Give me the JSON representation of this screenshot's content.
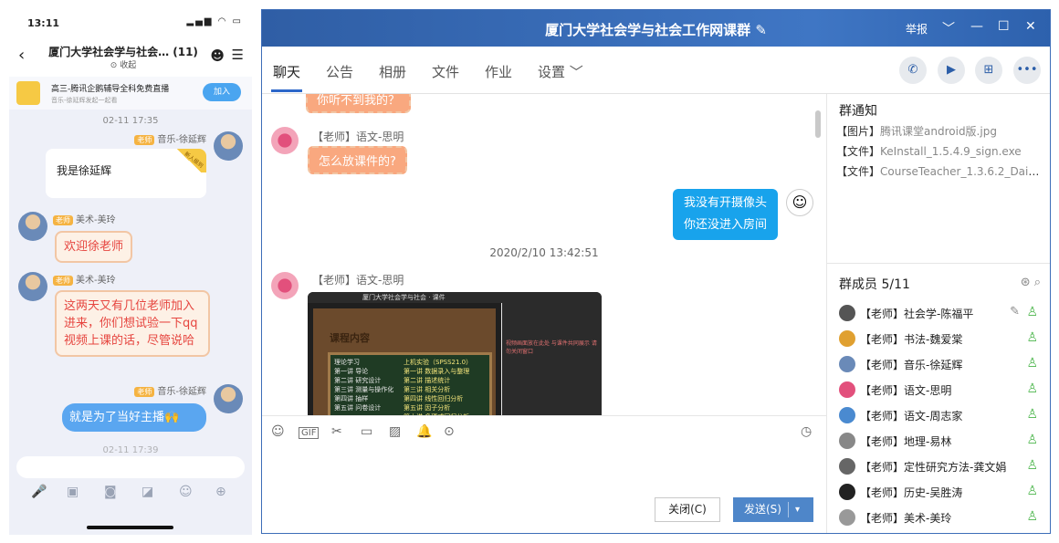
{
  "phone": {
    "status_time": "13:11",
    "status_icons": "▂▄▆ ◠ ▭",
    "back_icon": "‹",
    "title": "厦门大学社会学与社会…  (11)",
    "subtitle": "⊙ 收起",
    "emoji_icon": "☻",
    "menu_icon": "☰",
    "ad_title": "高三-腾讯企鹅辅导全科免费直播",
    "ad_sub": "音乐-徐延辉发起一起看",
    "ad_join": "加入",
    "new_badge": "新人报到",
    "messages": [
      {
        "time": "02-11 17:35"
      },
      {
        "tag": "老师",
        "sender": "音乐-徐延辉",
        "text": "我是徐延辉"
      },
      {
        "tag": "老师",
        "sender": "美术-美玲",
        "text": "欢迎徐老师"
      },
      {
        "tag": "老师",
        "sender": "美术-美玲",
        "text": "这两天又有几位老师加入进来，你们想试验一下qq视频上课的话，尽管说哈"
      },
      {
        "tag": "老师",
        "sender": "音乐-徐延辉",
        "text": "就是为了当好主播🙌"
      },
      {
        "time": "02-11 17:39"
      }
    ],
    "toolbar_icons": [
      "🎤",
      "▣",
      "◙",
      "◪",
      "☺",
      "⊕"
    ]
  },
  "window": {
    "title": "厦门大学社会学与社会工作网课群 ✎",
    "report": "举报",
    "controls": [
      "﹀",
      "—",
      "☐",
      "✕"
    ],
    "tabs": [
      "聊天",
      "公告",
      "相册",
      "文件",
      "作业",
      "设置 ﹀"
    ],
    "action_icons": [
      "✆",
      "▶",
      "⊞",
      "•••"
    ],
    "chat": {
      "top_bubble": "你听不到我的？",
      "sender1": "【老师】语文-思明",
      "msg1": "怎么放课件的?",
      "me_avatar": "☺",
      "me_text_1": "我没有开摄像头",
      "me_text_2": "你还没进入房间",
      "timestamp": "2020/2/10 13:42:51",
      "sender2": "【老师】语文-思明",
      "shot_title": "厦门大学社会学与社会 · 课件",
      "shot_heading": "课程内容",
      "shot_col1": "理论学习\n第一讲 导论\n第二讲 研究设计\n第三讲 测量与操作化\n第四讲 抽样\n第五讲 问卷设计",
      "shot_col2": "上机实验（SPSS21.0）\n第一讲 数据录入与整理\n第二讲 描述统计\n第三讲 相关分析\n第四讲 线性回归分析\n第五讲 因子分析\n第六讲 多项式回归分析\n第七讲 逻辑回归",
      "shot_side": "视频画面放在此处\n与课件共同展示\n请勿关闭窗口"
    },
    "composer": {
      "icons": [
        "☺",
        "GIF",
        "✂",
        "▭",
        "▨",
        "🔔",
        "⊙"
      ],
      "history_icon": "◷",
      "close_label": "关闭(C)",
      "send_label": "发送(S)",
      "send_arrow": "▾"
    },
    "notice_title": "群通知",
    "notices": [
      {
        "tag": "【图片】",
        "name": "腾讯课堂android版.jpg"
      },
      {
        "tag": "【文件】",
        "name": "KeInstall_1.5.4.9_sign.exe"
      },
      {
        "tag": "【文件】",
        "name": "CourseTeacher_1.3.6.2_Daily..."
      }
    ],
    "members_title": "群成员 5/11",
    "members_tools": "⊛ ⌕",
    "members": [
      "【老师】社会学-陈福平",
      "【老师】书法-魏爱棠",
      "【老师】音乐-徐延辉",
      "【老师】语文-思明",
      "【老师】语文-周志家",
      "【老师】地理-易林",
      "【老师】定性研究方法-龚文娟",
      "【老师】历史-吴胜涛",
      "【老师】美术-美玲"
    ],
    "member_status_icon": "♙",
    "member_edit_icon": "✎"
  },
  "colors": {
    "title_bar": "#3a6db8",
    "accent_blue": "#18a3ec",
    "peach": "#f9a87f",
    "send_button": "#4e86c9"
  }
}
